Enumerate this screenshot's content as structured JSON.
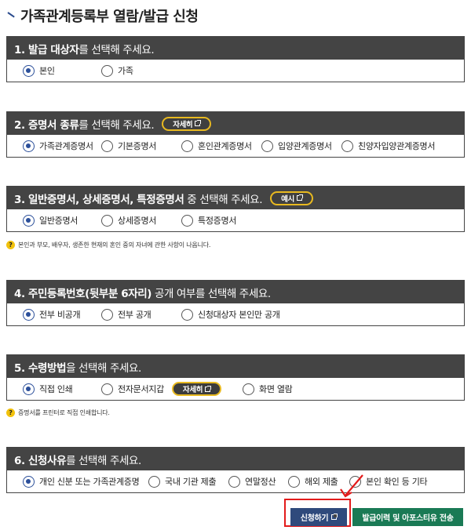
{
  "page": {
    "title": "가족관계등록부 열람/발급 신청"
  },
  "sections": [
    {
      "heading_bold": "1. 발급 대상자",
      "heading_rest": "를 선택해 주세요.",
      "options": [
        {
          "label": "본인",
          "selected": true
        },
        {
          "label": "가족",
          "selected": false
        }
      ]
    },
    {
      "heading_bold": "2. 증명서 종류",
      "heading_rest": "를 선택해 주세요.",
      "pill_label": "자세히",
      "options": [
        {
          "label": "가족관계증명서",
          "selected": true
        },
        {
          "label": "기본증명서",
          "selected": false
        },
        {
          "label": "혼인관계증명서",
          "selected": false
        },
        {
          "label": "입양관계증명서",
          "selected": false
        },
        {
          "label": "친양자입양관계증명서",
          "selected": false
        }
      ]
    },
    {
      "heading_bold": "3. 일반증명서, 상세증명서, 특정증명서",
      "heading_rest": " 중 선택해 주세요.",
      "pill_label": "예시",
      "options": [
        {
          "label": "일반증명서",
          "selected": true
        },
        {
          "label": "상세증명서",
          "selected": false
        },
        {
          "label": "특정증명서",
          "selected": false
        }
      ],
      "note": "본인과 부모, 배우자, 생존한 현재의 혼인 중의 자녀에 관한 사항이 나옵니다."
    },
    {
      "heading_bold": "4. 주민등록번호(뒷부분 6자리)",
      "heading_rest": " 공개 여부를 선택해 주세요.",
      "options": [
        {
          "label": "전부 비공개",
          "selected": true
        },
        {
          "label": "전부 공개",
          "selected": false
        },
        {
          "label": "신청대상자 본인만 공개",
          "selected": false
        }
      ]
    },
    {
      "heading_bold": "5. 수령방법",
      "heading_rest": "을 선택해 주세요.",
      "inline_pill_label": "자세히",
      "options": [
        {
          "label": "직접 인쇄",
          "selected": true
        },
        {
          "label": "전자문서지갑",
          "selected": false
        },
        {
          "label": "화면 열람",
          "selected": false
        }
      ],
      "note": "증명서를 프린터로 직접 인쇄합니다."
    },
    {
      "heading_bold": "6. 신청사유",
      "heading_rest": "를 선택해 주세요.",
      "options": [
        {
          "label": "개인 신분 또는 가족관계증명",
          "selected": true
        },
        {
          "label": "국내 기관 제출",
          "selected": false
        },
        {
          "label": "연말정산",
          "selected": false
        },
        {
          "label": "해외 제출",
          "selected": false
        },
        {
          "label": "본인 확인 등 기타",
          "selected": false
        }
      ]
    }
  ],
  "buttons": {
    "apply_label": "신청하기",
    "send_label": "발급이력 및 아포스티유 전송"
  },
  "colors": {
    "header_bg": "#444444",
    "radio_selected": "#2b4f9a",
    "pill_border": "#e8b920",
    "apply_bg": "#2f4a7c",
    "send_bg": "#1a7a55",
    "highlight": "#e31b1b"
  }
}
